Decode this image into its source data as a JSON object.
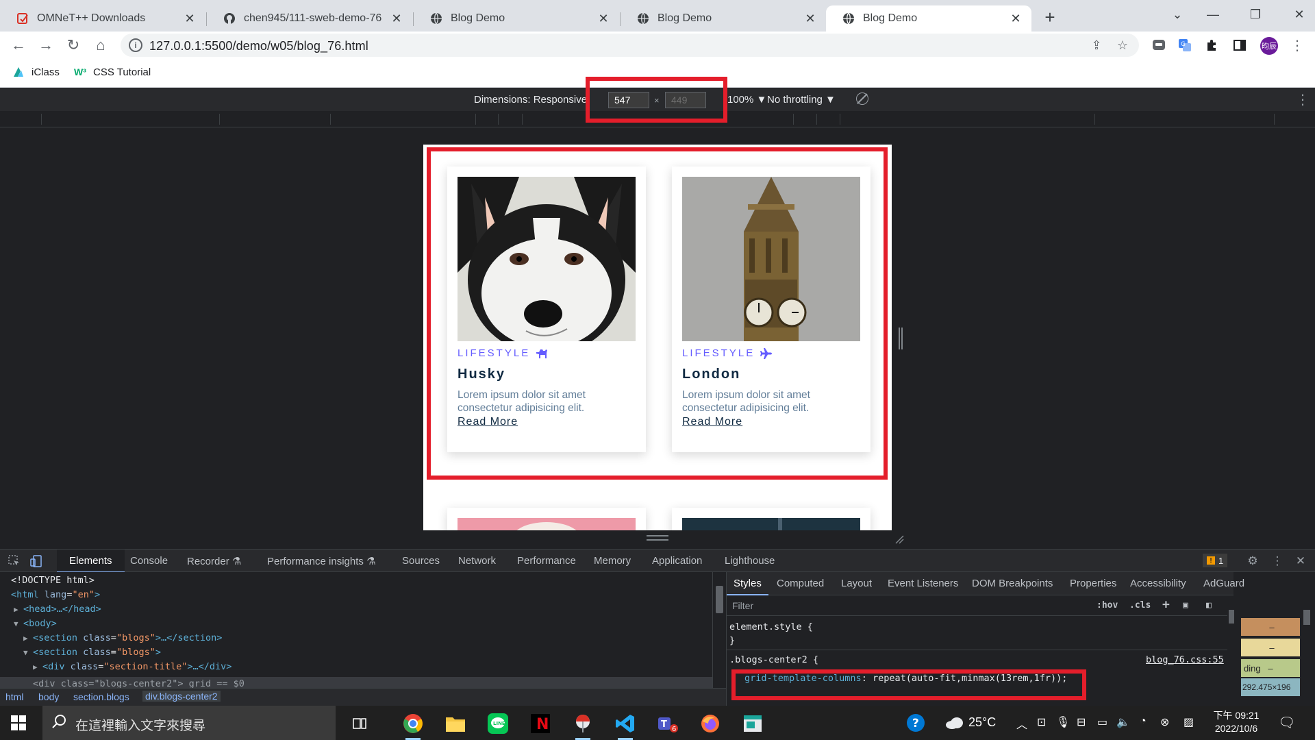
{
  "tabs": [
    {
      "title": "OMNeT++ Downloads",
      "icon": "omnet-icon"
    },
    {
      "title": "chen945/111-sweb-demo-76",
      "icon": "github-icon"
    },
    {
      "title": "Blog Demo",
      "icon": "globe-icon"
    },
    {
      "title": "Blog Demo",
      "icon": "globe-icon"
    },
    {
      "title": "Blog Demo",
      "icon": "globe-icon",
      "active": true
    }
  ],
  "address": {
    "url": "127.0.0.1:5500/demo/w05/blog_76.html"
  },
  "bookmarks": [
    {
      "label": "iClass",
      "icon": "iclass-icon"
    },
    {
      "label": "CSS Tutorial",
      "icon": "w3schools-icon"
    }
  ],
  "device_toolbar": {
    "dimensions_label": "Dimensions: Responsive",
    "width": "547",
    "height_placeholder": "449",
    "times": "×",
    "zoom": "100% ▼",
    "throttling": "No throttling ▼"
  },
  "page": {
    "cards": [
      {
        "category": "LIFESTYLE",
        "category_icon": "dog-icon",
        "title": "Husky",
        "text": "Lorem ipsum dolor sit amet consectetur adipisicing elit.",
        "link": "Read More"
      },
      {
        "category": "LIFESTYLE",
        "category_icon": "plane-icon",
        "title": "London",
        "text": "Lorem ipsum dolor sit amet consectetur adipisicing elit.",
        "link": "Read More"
      }
    ],
    "accent_color": "#645cff"
  },
  "devtools": {
    "tabs": [
      "Elements",
      "Console",
      "Recorder ⚗",
      "Performance insights ⚗",
      "Sources",
      "Network",
      "Performance",
      "Memory",
      "Application",
      "Lighthouse"
    ],
    "active_tab": "Elements",
    "issues_count": "1",
    "dom": {
      "doctype": "<!DOCTYPE html>",
      "html_tag": "html",
      "lang_attr": "lang",
      "lang_value": "\"en\"",
      "head": "<head>…</head>",
      "body_tag": "<body>",
      "section1_open": "<section ",
      "section1_attr": "class",
      "section1_val": "\"blogs\"",
      "section1_rest": ">…</section>",
      "section2_open": "<section ",
      "section2_attr": "class",
      "section2_val": "\"blogs\"",
      "section2_close": ">",
      "div_title_open": "<div ",
      "div_title_attr": "class",
      "div_title_val": "\"section-title\"",
      "div_title_rest": ">…</div>",
      "div_center_text": "<div class=\"blogs-center2\"> grid == $0"
    },
    "breadcrumbs": [
      "html",
      "body",
      "section.blogs",
      "div.blogs-center2"
    ],
    "styles_tabs": [
      "Styles",
      "Computed",
      "Layout",
      "Event Listeners",
      "DOM Breakpoints",
      "Properties",
      "Accessibility",
      "AdGuard"
    ],
    "filter_placeholder": "Filter",
    "filter_hov": ":hov",
    "filter_cls": ".cls",
    "element_style": "element.style {",
    "element_style_close": "}",
    "rule_selector": ".blogs-center2 {",
    "rule_source": "blog_76.css:55",
    "rule_prop": "grid-template-columns",
    "rule_value": ": repeat(auto-fit,minmax(13rem,1fr));",
    "boxmodel_label": "ding",
    "boxmodel_dash": "–",
    "boxmodel_size": "292.475×196"
  },
  "taskbar": {
    "search_placeholder": "在這裡輸入文字來搜尋",
    "temperature": "25°C",
    "time": "下午 09:21",
    "date": "2022/10/6",
    "teams_badge": "6"
  }
}
